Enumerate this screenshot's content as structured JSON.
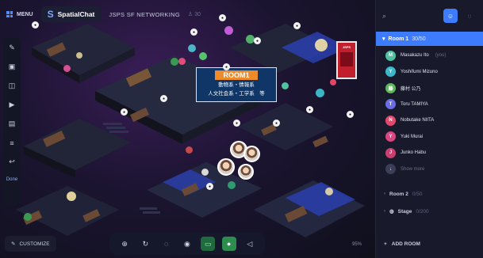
{
  "topbar": {
    "menu_label": "MENU",
    "brand_name": "SpatialChat",
    "room_name": "JSPS SF NETWORKING",
    "room_count": "30"
  },
  "map": {
    "room_label_title": "ROOM1",
    "room_label_line1": "動物系・情報系",
    "room_label_line2": "人文社会系・工学系　等",
    "poster_text": "JSPS"
  },
  "rail": {
    "done_label": "Done"
  },
  "bottom": {
    "customize_label": "CUSTOMIZE",
    "zoom": "95%"
  },
  "panel": {
    "room1": {
      "name": "Room 1",
      "count": "30/50"
    },
    "members": [
      {
        "initial": "M",
        "name": "Masakazu Ito",
        "tag": "(you)",
        "color": "#4fc2a0"
      },
      {
        "initial": "Y",
        "name": "Yoshifumi Mizuno",
        "tag": "",
        "color": "#3db7c9"
      },
      {
        "initial": "藤",
        "name": "藤村 公乃",
        "tag": "",
        "color": "#5db85a"
      },
      {
        "initial": "T",
        "name": "Toru TAMIYA",
        "tag": "",
        "color": "#6a6ee6"
      },
      {
        "initial": "N",
        "name": "Nobutake NIITA",
        "tag": "",
        "color": "#e0486e"
      },
      {
        "initial": "Y",
        "name": "Yuki Murai",
        "tag": "",
        "color": "#d8477f"
      },
      {
        "initial": "J",
        "name": "Junko Habu",
        "tag": "",
        "color": "#c9406e"
      }
    ],
    "show_more": "Show more",
    "room2": {
      "name": "Room 2",
      "count": "0/50"
    },
    "stage": {
      "name": "Stage",
      "count": "0/200"
    },
    "add_room": "ADD ROOM"
  }
}
